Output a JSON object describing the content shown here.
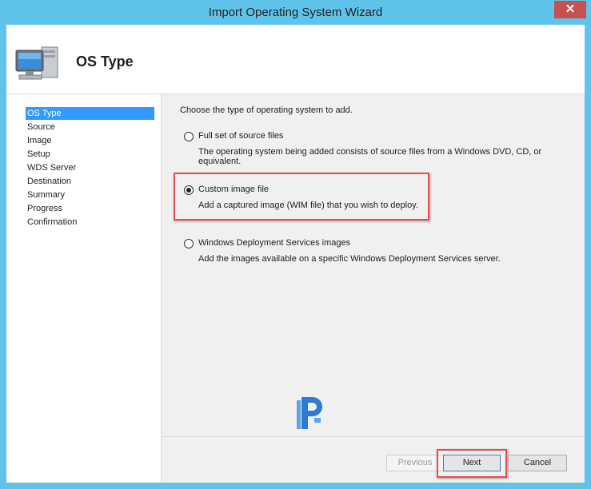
{
  "window": {
    "title": "Import Operating System Wizard",
    "close_glyph": "✕"
  },
  "header": {
    "title": "OS Type",
    "icon": "computer-icon"
  },
  "nav": {
    "items": [
      {
        "label": "OS Type",
        "active": true
      },
      {
        "label": "Source"
      },
      {
        "label": "Image"
      },
      {
        "label": "Setup"
      },
      {
        "label": "WDS Server"
      },
      {
        "label": "Destination"
      },
      {
        "label": "Summary"
      },
      {
        "label": "Progress"
      },
      {
        "label": "Confirmation"
      }
    ]
  },
  "content": {
    "prompt": "Choose the type of operating system to add.",
    "options": [
      {
        "label": "Full set of source files",
        "description": "The operating system being added consists of source files from a Windows DVD, CD, or equivalent.",
        "selected": false
      },
      {
        "label": "Custom image file",
        "description": "Add a captured image (WIM file) that you wish to deploy.",
        "selected": true
      },
      {
        "label": "Windows Deployment Services images",
        "description": "Add the images available on a specific Windows Deployment Services server.",
        "selected": false
      }
    ]
  },
  "buttons": {
    "previous": "Previous",
    "next": "Next",
    "cancel": "Cancel"
  },
  "colors": {
    "title_bar": "#5fc3ea",
    "selection": "#3399ff",
    "highlight_box": "#e84c4c",
    "close_button": "#c75050"
  }
}
